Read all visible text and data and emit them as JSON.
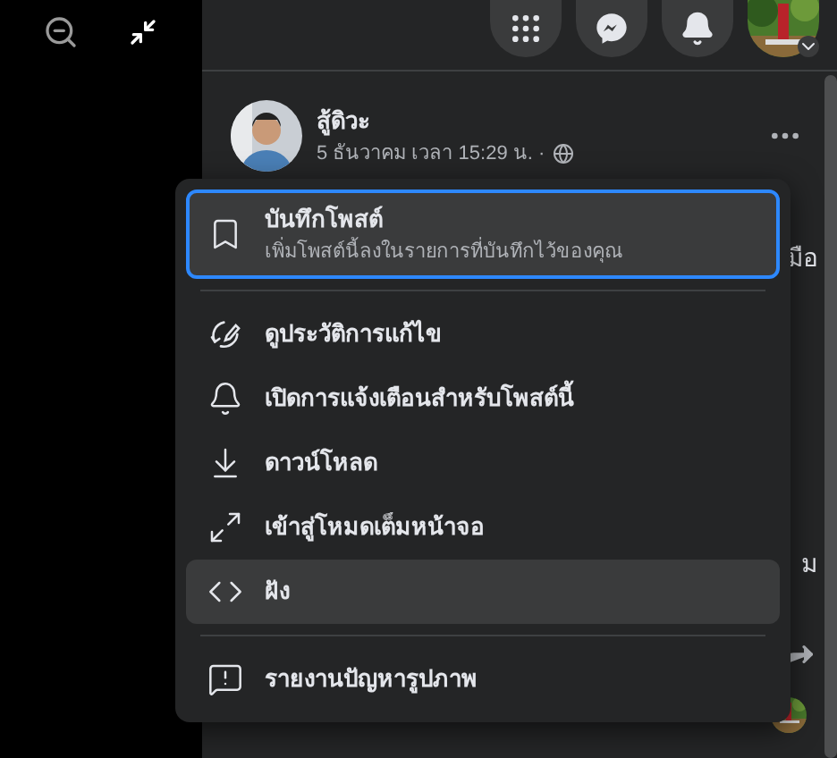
{
  "post": {
    "author": "สู้ดิวะ",
    "time": "5 ธันวาคม เวลา 15:29 น. ·",
    "text_fragments": [
      "มือ",
      "ม"
    ]
  },
  "menu": {
    "items": [
      {
        "kind": "save",
        "label": "บันทึกโพสต์",
        "description": "เพิ่มโพสต์นี้ลงในรายการที่บันทึกไว้ของคุณ",
        "focused": true,
        "hovered": false
      },
      {
        "kind": "divider"
      },
      {
        "kind": "action",
        "label": "ดูประวัติการแก้ไข",
        "focused": false,
        "hovered": false
      },
      {
        "kind": "action",
        "label": "เปิดการแจ้งเตือนสำหรับโพสต์นี้",
        "focused": false,
        "hovered": false
      },
      {
        "kind": "action",
        "label": "ดาวน์โหลด",
        "focused": false,
        "hovered": false
      },
      {
        "kind": "action",
        "label": "เข้าสู่โหมดเต็มหน้าจอ",
        "focused": false,
        "hovered": false
      },
      {
        "kind": "action",
        "label": "ฝัง",
        "focused": false,
        "hovered": true
      },
      {
        "kind": "divider"
      },
      {
        "kind": "action",
        "label": "รายงานปัญหารูปภาพ",
        "focused": false,
        "hovered": false
      }
    ]
  }
}
